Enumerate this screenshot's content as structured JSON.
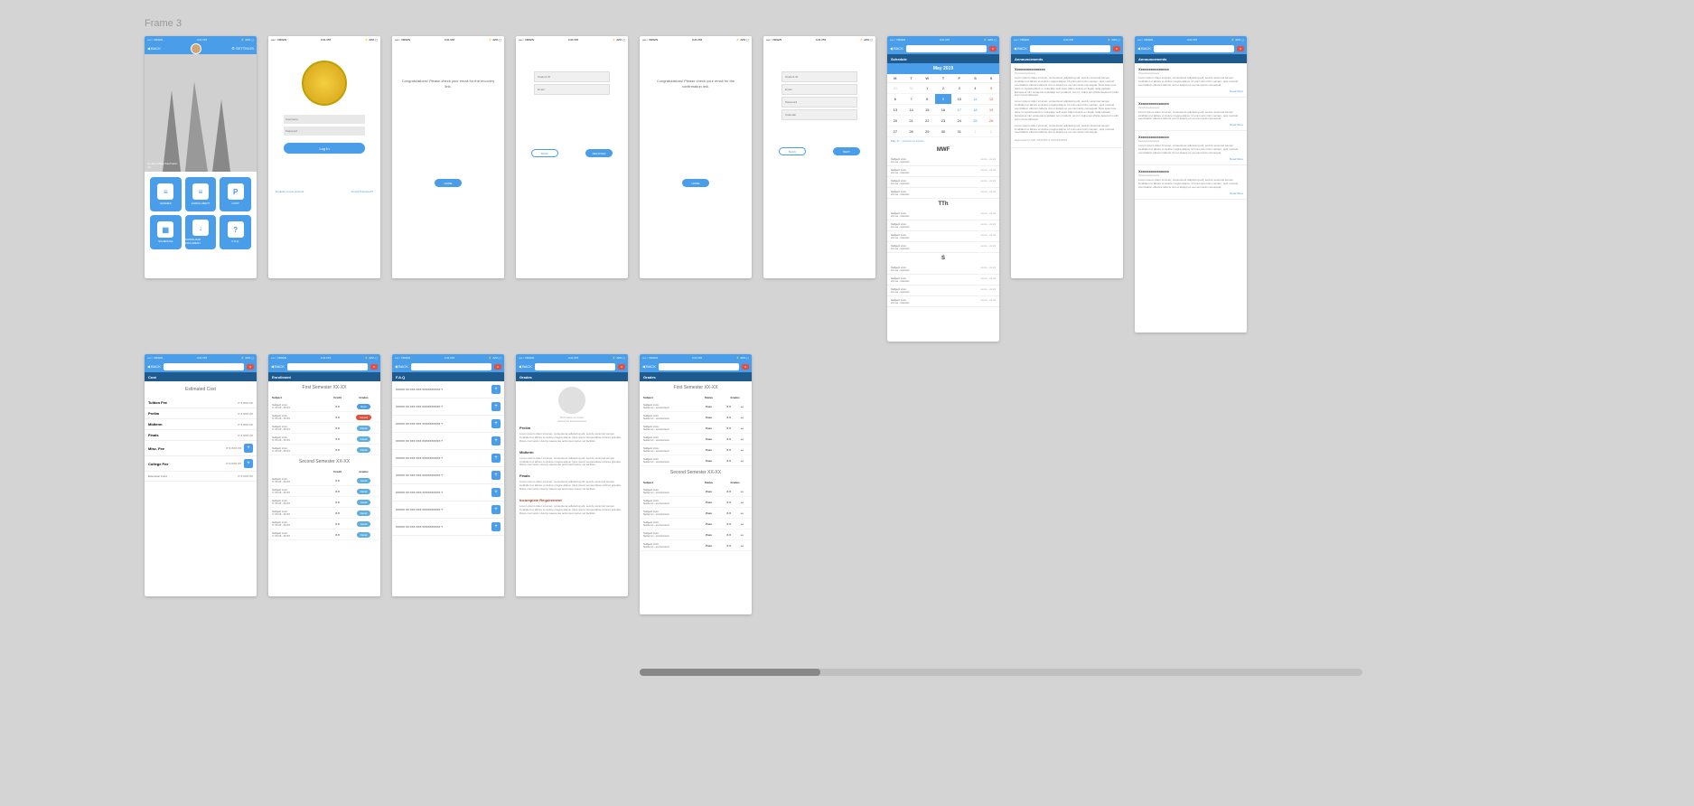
{
  "frame_label": "Frame 3",
  "statusbar": {
    "carrier": "••••○ VIRGIN",
    "wifi": "⌃",
    "time": "4:21 PM",
    "battery": "⚡ 22% ▢"
  },
  "nav": {
    "back": "BACK",
    "settings": "SETTINGS",
    "close": "X"
  },
  "home": {
    "hero_credit": "by Jane Marie Kaufmann",
    "hero_sub": "Art",
    "tiles": [
      {
        "icon": "≡",
        "label": "GRADES"
      },
      {
        "icon": "≡",
        "label": "ENROLLMENT"
      },
      {
        "icon": "P",
        "label": "COST"
      },
      {
        "icon": "▦",
        "label": "SCHEDULE"
      },
      {
        "icon": "↓",
        "label": "DOWNLOAD DOCUMENT"
      },
      {
        "icon": "?",
        "label": "F.A.Q."
      }
    ]
  },
  "login": {
    "username_ph": "Username",
    "password_ph": "Password",
    "login_btn": "Log In",
    "register": "Register a new account",
    "forgot": "Forgot Password?"
  },
  "recovery_msg": "Congratulations! Please check your email for the recovery link.",
  "confirm_msg": "Congratulations! Please check your email for the confirmation link.",
  "buttons": {
    "home": "HOME",
    "back": "BACK",
    "recover": "RECOVER",
    "next": "NEXT"
  },
  "form": {
    "student_id": "Student ID",
    "email": "Email",
    "password": "Password",
    "calendar": "Calendar"
  },
  "calendar": {
    "title": "May 2019",
    "dow": [
      "M",
      "T",
      "W",
      "T",
      "F",
      "S",
      "S"
    ],
    "weeks": [
      [
        {
          "d": "29",
          "dim": true
        },
        {
          "d": "30",
          "dim": true
        },
        {
          "d": "1"
        },
        {
          "d": "2"
        },
        {
          "d": "3"
        },
        {
          "d": "4"
        },
        {
          "d": "5",
          "sun": true
        }
      ],
      [
        {
          "d": "6"
        },
        {
          "d": "7"
        },
        {
          "d": "8"
        },
        {
          "d": "9",
          "today": true
        },
        {
          "d": "10"
        },
        {
          "d": "11",
          "sat": true
        },
        {
          "d": "12",
          "sun": true
        }
      ],
      [
        {
          "d": "13"
        },
        {
          "d": "14"
        },
        {
          "d": "15"
        },
        {
          "d": "16"
        },
        {
          "d": "17",
          "sat": true
        },
        {
          "d": "18",
          "sat": true
        },
        {
          "d": "19",
          "sun": true
        }
      ],
      [
        {
          "d": "20"
        },
        {
          "d": "21"
        },
        {
          "d": "22"
        },
        {
          "d": "23"
        },
        {
          "d": "24"
        },
        {
          "d": "25",
          "sat": true
        },
        {
          "d": "26",
          "sun": true
        }
      ],
      [
        {
          "d": "27"
        },
        {
          "d": "28"
        },
        {
          "d": "29"
        },
        {
          "d": "30"
        },
        {
          "d": "31"
        },
        {
          "d": "1",
          "dim": true
        },
        {
          "d": "2",
          "dim": true
        }
      ]
    ],
    "event": "May 17 - xxxxxxx xx xxxxxx",
    "days": [
      "MWF",
      "TTh",
      "S"
    ],
    "schedule_item": {
      "subj": "Subject xxxx",
      "det": "xxx xxx - xxxxxxxx",
      "time": "xx:xx - xx:xx"
    }
  },
  "tabs": {
    "schedule": "Schedule",
    "announcements": "Announcements",
    "cost": "Cost",
    "enrollment": "Enrollment",
    "faq": "F.A.Q",
    "grades": "Grades"
  },
  "announcement": {
    "title": "Xxxxxxxxxxxxxxx",
    "sub": "Xxxxxxxxxxxxxxx",
    "body": "Lorem ipsum dolor sit amet, consectetur adipiscing elit, sed do eiusmod tempor incididunt ut labore et dolore magna aliqua. Ut enim ad minim veniam, quis nostrud exercitation ullamco laboris nisi ut aliquip ex ea commodo consequat. Duis aute irure dolor in reprehenderit in voluptate velit esse cillum dolore eu fugiat nulla pariatur. Excepteur sint occaecat cupidatat non proident, sunt in culpa qui officia deserunt mollit anim id est laborum.",
    "body_short": "Lorem ipsum dolor sit amet, consectetur adipiscing elit, sed do eiusmod tempor incididunt ut labore et dolore magna aliqua. Ut enim ad minim veniam, quis nostrud exercitation ullamco laboris nisi ut aliquip ex ea commodo consequat.",
    "link": "Read More",
    "approved": "Approved by: DR. XXXXXX X XXXXXXXXX"
  },
  "cost": {
    "title": "Estimated Cost",
    "rows": [
      {
        "label": "Tuition Fee",
        "val": "P X,XXX.XX"
      },
      {
        "label": "Prelim",
        "val": "P X,XXX.XX"
      },
      {
        "label": "Midterm",
        "val": "P X,XXX.XX"
      },
      {
        "label": "Finals",
        "val": "P X,XXX.XX"
      },
      {
        "label": "Misc. Fee",
        "val": "P X,XXX.XX",
        "plus": true
      },
      {
        "label": "College Fee",
        "val": "P X,XXX.XX",
        "plus": true
      }
    ],
    "extra": {
      "label": "Extension Fund",
      "val": "P X,XXX.XX"
    }
  },
  "enrollment": {
    "sem1": "First Semester XX-XX",
    "sem2": "Second Semester XX-XX",
    "headers": [
      "Subject",
      "Credit",
      "Grades"
    ],
    "subj": {
      "name": "Subject xxxx",
      "det": "X: XX:XX - XX:XX",
      "credit": "X.X"
    },
    "subj_multi": {
      "name": "Subject xxxx",
      "det": "X: XX:XX - XX:XX\nX: XX:XX - XX:XX",
      "credit": "X.X"
    },
    "pills": {
      "open": "Open",
      "closed": "Closed",
      "detail": "Detail"
    }
  },
  "faq": {
    "question": "XXXXX XX XXX XXX XXXXXXXXXX ?"
  },
  "prof": {
    "name": "Prof name xx xxxxx",
    "dept": "xxxxxx xx xxxxxxxxxxxx",
    "sections": [
      "Prelim",
      "Midterm",
      "Finals"
    ],
    "incomplete": "Incomplete Requirement",
    "body": "Lorem ipsum dolor sit amet, consectetur adipiscing elit, sed do eiusmod tempor incididunt ut labore et dolore magna aliqua. Quis ipsum suspendisse ultrices gravida. Risus commodo viverra maecenas accumsan lacus vel facilisis."
  },
  "grades": {
    "headers": [
      "Subject",
      "Status",
      "Grades"
    ],
    "row": {
      "name": "Subject xxxx",
      "det": "Section xx - xxxxxxxxxxxx",
      "status": "Pass",
      "grade": "X.X",
      "dots": "•••"
    }
  }
}
